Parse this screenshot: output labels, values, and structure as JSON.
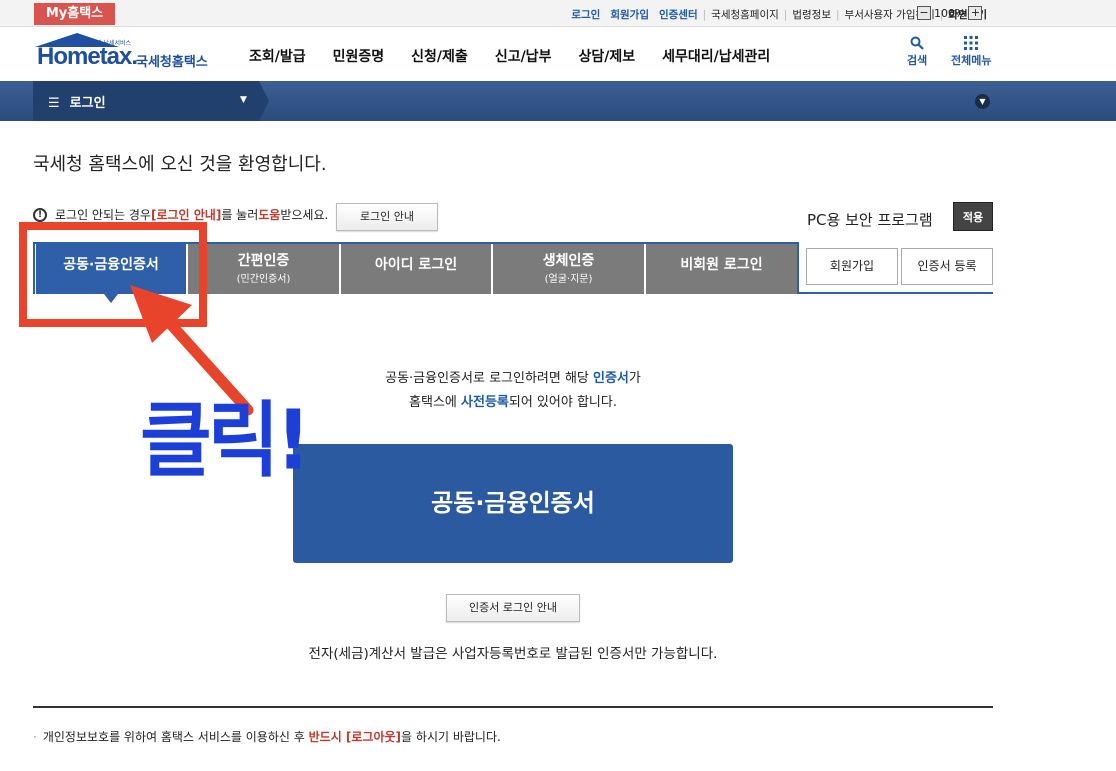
{
  "topbar": {
    "my_hometax": "My홈택스",
    "links": [
      "로그인",
      "회원가입",
      "인증센터",
      "국세청홈페이지",
      "법령정보",
      "부서사용자 가입하기",
      "화면크기"
    ],
    "zoom_minus": "−",
    "zoom_value": "100%",
    "zoom_plus": "+"
  },
  "header": {
    "logo_brand": "Hometax.",
    "logo_tagline": "친하게 납세서비스",
    "logo_name": "국세청홈택스",
    "menu": [
      "조회/발급",
      "민원증명",
      "신청/제출",
      "신고/납부",
      "상담/제보",
      "세무대리/납세관리"
    ],
    "search_label": "검색",
    "allmenu_label": "전체메뉴"
  },
  "navbar": {
    "current": "로그인"
  },
  "main": {
    "welcome": "국세청 홈택스에 오신 것을 환영합니다.",
    "notice_prefix": "로그인 안되는 경우 ",
    "notice_link": "[로그인 안내]",
    "notice_mid": "를 눌러 ",
    "notice_help": "도움",
    "notice_suffix": "받으세요.",
    "login_guide_btn": "로그인 안내",
    "pc_security_label": "PC용 보안 프로그램",
    "apply_btn": "적용",
    "tabs": [
      {
        "label": "공동·금융인증서",
        "sub": ""
      },
      {
        "label": "간편인증",
        "sub": "(민간인증서)"
      },
      {
        "label": "아이디 로그인",
        "sub": ""
      },
      {
        "label": "생체인증",
        "sub": "(얼굴·지문)"
      },
      {
        "label": "비회원 로그인",
        "sub": ""
      }
    ],
    "signup_btn": "회원가입",
    "cert_register_btn": "인증서 등록",
    "desc1_a": "공동·금융인증서로 로그인하려면 해당 ",
    "desc1_b": "인증서",
    "desc1_c": "가",
    "desc2_a": "홈택스에 ",
    "desc2_b": "사전등록",
    "desc2_c": "되어 있어야 합니다.",
    "cert_login_btn": "공동·금융인증서",
    "cert_guide_btn": "인증서 로그인 안내",
    "tax_invoice_note": "전자(세금)계산서 발급은 사업자등록번호로 발급된 인증서만 가능합니다.",
    "footnote_a": "개인정보보호를 위하여 홈택스 서비스를 이용하신 후 ",
    "footnote_b": "반드시 [로그아웃]",
    "footnote_c": "을 하시기 바랍니다."
  },
  "annotation": {
    "click_text": "클릭!",
    "color": "#e8442c",
    "text_color": "#1c3fd8"
  }
}
